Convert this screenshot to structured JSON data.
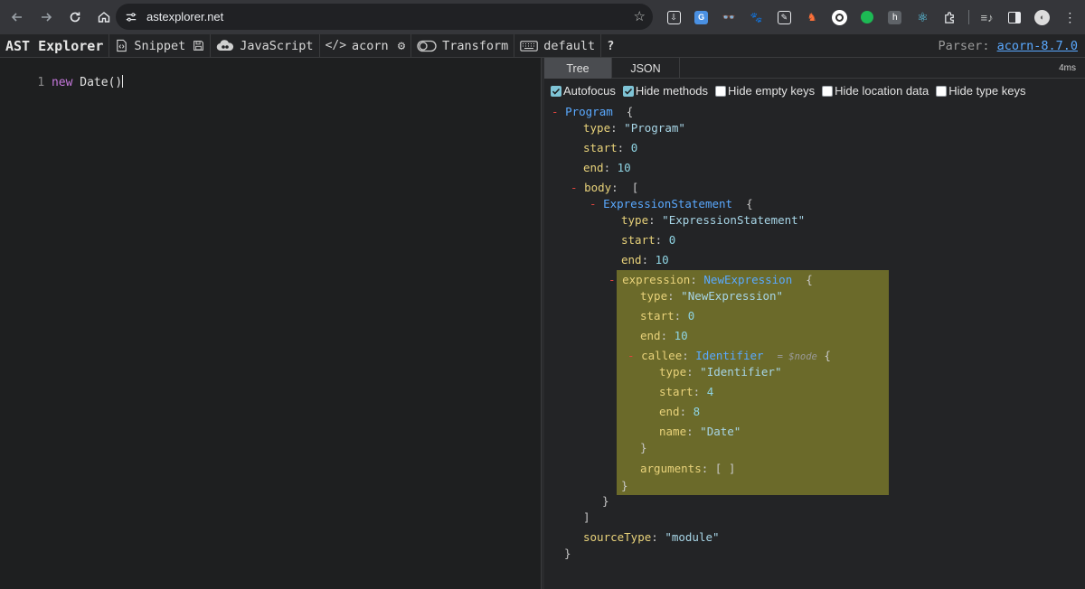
{
  "browser": {
    "url": "astexplorer.net",
    "extensions": [
      {
        "name": "ext-download-icon",
        "color": "#e8eaed"
      },
      {
        "name": "ext-translate-icon",
        "color": "#4a90e2"
      },
      {
        "name": "ext-glasses-icon",
        "color": "#c4c7c5"
      },
      {
        "name": "ext-paw-icon",
        "color": "#c4c7c5"
      },
      {
        "name": "ext-pen-icon",
        "color": "#e8eaed"
      },
      {
        "name": "ext-fox-icon",
        "color": "#ff7139"
      },
      {
        "name": "ext-circle-icon",
        "color": "#ffffff"
      },
      {
        "name": "ext-green-dot-icon",
        "color": "#1db954"
      },
      {
        "name": "ext-h-icon",
        "color": "#9aa0a6"
      },
      {
        "name": "ext-react-icon",
        "color": "#61dafb"
      },
      {
        "name": "ext-puzzle-icon",
        "color": "#c4c7c5"
      }
    ]
  },
  "toolbar": {
    "brand": "AST Explorer",
    "snippet": "Snippet",
    "language": "JavaScript",
    "parser_name": "acorn",
    "transform": "Transform",
    "keymap": "default",
    "help": "?",
    "parser_label": "Parser:",
    "parser_version": "acorn-8.7.0"
  },
  "editor": {
    "line_number": "1",
    "keyword": "new",
    "code_rest": " Date()"
  },
  "output": {
    "tabs": [
      "Tree",
      "JSON"
    ],
    "active_tab": "Tree",
    "time": "4ms",
    "options": [
      {
        "label": "Autofocus",
        "checked": true
      },
      {
        "label": "Hide methods",
        "checked": true
      },
      {
        "label": "Hide empty keys",
        "checked": false
      },
      {
        "label": "Hide location data",
        "checked": false
      },
      {
        "label": "Hide type keys",
        "checked": false
      }
    ]
  },
  "tree": {
    "program_type": "Program",
    "program_type_value": "\"Program\"",
    "program_start": "0",
    "program_end": "10",
    "body_key": "body",
    "stmt_type": "ExpressionStatement",
    "stmt_type_value": "\"ExpressionStatement\"",
    "stmt_start": "0",
    "stmt_end": "10",
    "expr_key": "expression",
    "expr_type": "NewExpression",
    "expr_type_value": "\"NewExpression\"",
    "expr_start": "0",
    "expr_end": "10",
    "callee_key": "callee",
    "callee_type": "Identifier",
    "callee_hint": "= $node",
    "callee_type_value": "\"Identifier\"",
    "callee_start": "4",
    "callee_end": "8",
    "callee_name": "\"Date\"",
    "arguments_key": "arguments",
    "arguments_value": "[ ]",
    "source_type_key": "sourceType",
    "source_type_value": "\"module\""
  }
}
